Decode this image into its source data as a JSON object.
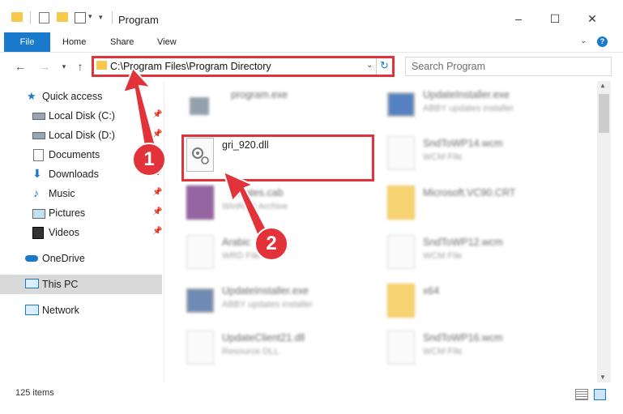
{
  "window": {
    "title": "Program"
  },
  "ribbon": {
    "file": "File",
    "tabs": [
      "Home",
      "Share",
      "View"
    ]
  },
  "address": {
    "path": "C:\\Program Files\\Program Directory"
  },
  "search": {
    "placeholder": "Search Program"
  },
  "nav": {
    "quick_access": "Quick access",
    "items": [
      {
        "label": "Local Disk (C:)",
        "icon": "drive-icon"
      },
      {
        "label": "Local Disk (D:)",
        "icon": "drive-icon"
      },
      {
        "label": "Documents",
        "icon": "documents-icon"
      },
      {
        "label": "Downloads",
        "icon": "download-icon"
      },
      {
        "label": "Music",
        "icon": "music-icon"
      },
      {
        "label": "Pictures",
        "icon": "pictures-icon"
      },
      {
        "label": "Videos",
        "icon": "videos-icon"
      }
    ],
    "onedrive": "OneDrive",
    "this_pc": "This PC",
    "network": "Network"
  },
  "files": {
    "highlighted": {
      "name": "gri_920.dll"
    },
    "left": [
      {
        "name": "program.exe",
        "sub": ""
      },
      {
        "name": "ificates.cab",
        "sub": "WinRAR Archive"
      },
      {
        "name": "Arabic",
        "sub": "WRD File"
      },
      {
        "name": "UpdateInstaller.exe",
        "sub": "ABBY updates installer"
      },
      {
        "name": "UpdateClient21.dll",
        "sub": "Resource DLL"
      }
    ],
    "right": [
      {
        "name": "UpdateInstaller.exe",
        "sub": "ABBY updates installer"
      },
      {
        "name": "SndToWP14.wcm",
        "sub": "WCM File"
      },
      {
        "name": "Microsoft.VC90.CRT",
        "sub": ""
      },
      {
        "name": "SndToWP12.wcm",
        "sub": "WCM File"
      },
      {
        "name": "x64",
        "sub": ""
      },
      {
        "name": "SndToWP16.wcm",
        "sub": "WCM File"
      }
    ]
  },
  "status": {
    "count": "125 items"
  },
  "callouts": {
    "one": "1",
    "two": "2"
  },
  "colors": {
    "accent": "#1979ca",
    "highlight": "#e2323a",
    "folder": "#f6c94e"
  }
}
